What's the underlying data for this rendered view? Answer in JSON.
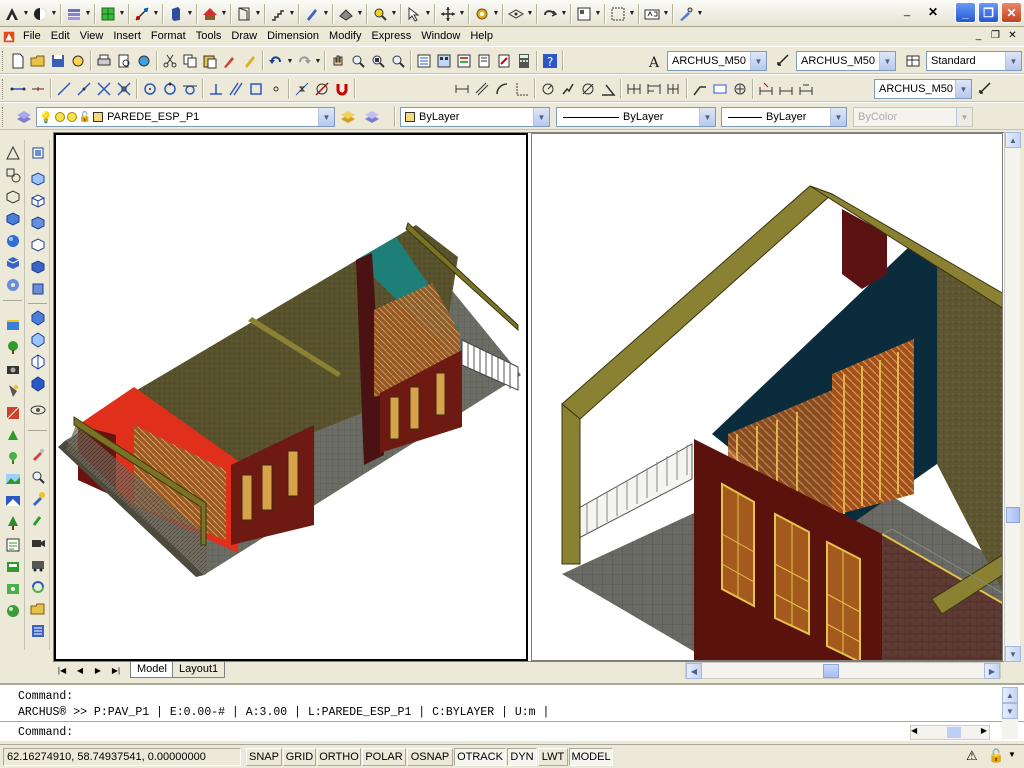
{
  "menu": {
    "items": [
      "File",
      "Edit",
      "View",
      "Insert",
      "Format",
      "Tools",
      "Draw",
      "Dimension",
      "Modify",
      "Express",
      "Window",
      "Help"
    ]
  },
  "styles": {
    "text_style": "ARCHUS_M50",
    "dim_style": "ARCHUS_M50",
    "table_style": "Standard",
    "multileader_style": "ARCHUS_M50"
  },
  "layers": {
    "current_layer": "PAREDE_ESP_P1",
    "color": "ByLayer",
    "linetype": "ByLayer",
    "lineweight": "ByLayer",
    "plot_style": "ByColor"
  },
  "tabs": [
    "Model",
    "Layout1"
  ],
  "command": {
    "line1": "Command:",
    "line2": "ARCHUS® >> P:PAV_P1 | E:0.00-# | A:3.00 | L:PAREDE_ESP_P1 | C:BYLAYER | U:m |",
    "line3": "Command:"
  },
  "status": {
    "coords": "62.16274910, 58.74937541, 0.00000000",
    "toggles": [
      {
        "label": "SNAP",
        "on": false
      },
      {
        "label": "GRID",
        "on": false
      },
      {
        "label": "ORTHO",
        "on": false
      },
      {
        "label": "POLAR",
        "on": false
      },
      {
        "label": "OSNAP",
        "on": false
      },
      {
        "label": "OTRACK",
        "on": true
      },
      {
        "label": "DYN",
        "on": true
      },
      {
        "label": "LWT",
        "on": false
      },
      {
        "label": "MODEL",
        "on": true
      }
    ]
  },
  "icons": {
    "top_toolbar": [
      "archus-logo-icon",
      "globe-icon",
      "layer-icon",
      "grid-icon",
      "snap-icon",
      "column-icon",
      "roof-icon",
      "door-icon",
      "stair-icon",
      "pencil-icon",
      "wall-icon",
      "zoom-extents-icon",
      "select-icon",
      "move-icon",
      "gear-icon",
      "ucs-icon",
      "undo-special-icon",
      "frame-icon",
      "window-icon",
      "grid-number-icon",
      "edit-icon"
    ],
    "colors": {
      "accent": "#2456d8",
      "ui": "#ece9d8"
    }
  }
}
